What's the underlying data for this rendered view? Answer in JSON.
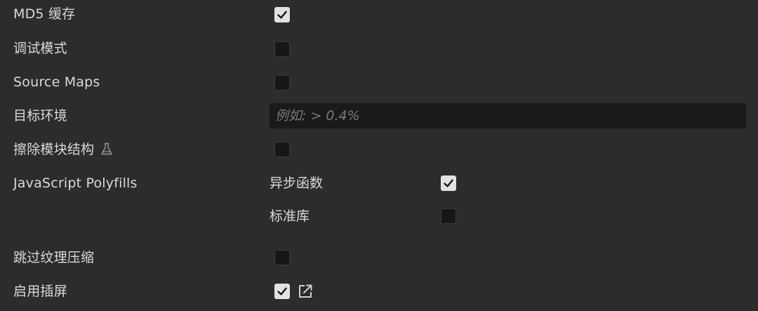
{
  "settings": {
    "md5_cache": {
      "label": "MD5 缓存",
      "checked": true
    },
    "debug_mode": {
      "label": "调试模式",
      "checked": false
    },
    "source_maps": {
      "label": "Source Maps",
      "checked": false
    },
    "target_env": {
      "label": "目标环境",
      "placeholder": "例如: > 0.4%",
      "value": ""
    },
    "erase_module_structure": {
      "label": "擦除模块结构",
      "icon": "flask-icon",
      "checked": false
    },
    "polyfills": {
      "label": "JavaScript Polyfills",
      "async_functions": {
        "label": "异步函数",
        "checked": true
      },
      "core_js": {
        "label": "标准库",
        "checked": false
      }
    },
    "skip_texture_compression": {
      "label": "跳过纹理压缩",
      "checked": false
    },
    "enable_splash_screen": {
      "label": "启用插屏",
      "checked": true,
      "edit_icon": "edit-icon"
    }
  }
}
